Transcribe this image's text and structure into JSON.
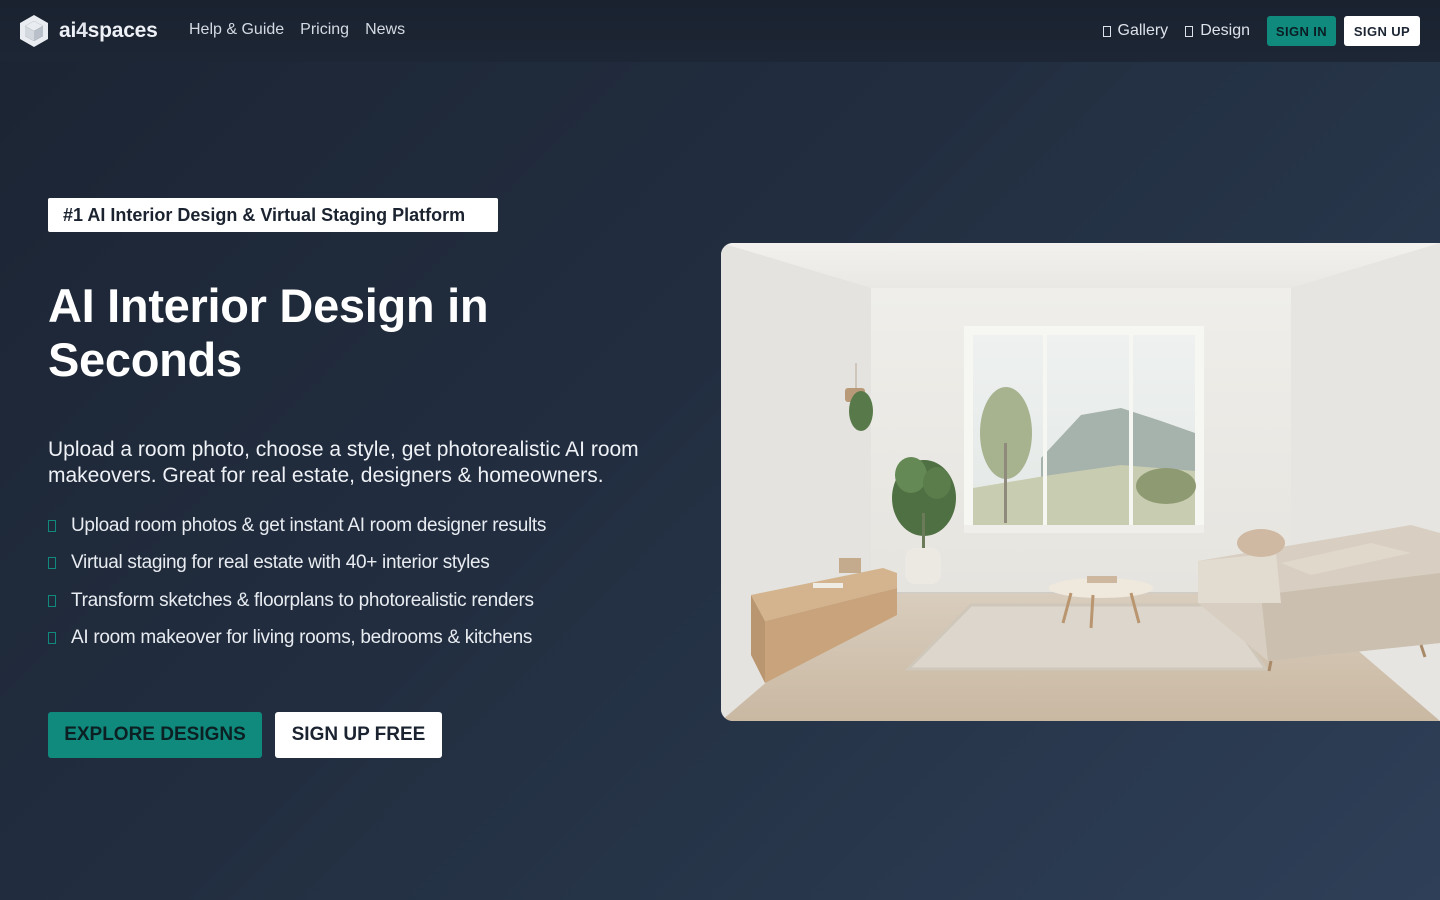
{
  "nav": {
    "brand_prefix": "ai",
    "brand_digit": "4",
    "brand_suffix": "spaces",
    "links": [
      "Help & Guide",
      "Pricing",
      "News"
    ],
    "gallery_label": "Gallery",
    "design_label": "Design",
    "signin_label": "SIGN IN",
    "signup_label": "SIGN UP"
  },
  "hero": {
    "badge": "#1 AI Interior Design & Virtual Staging Platform",
    "headline_line1": "AI Interior Design in",
    "headline_line2": "Seconds",
    "subline": "Upload a room photo, choose a style, get photorealistic AI room makeovers. Great for real estate, designers & homeowners.",
    "features": [
      "Upload room photos & get instant AI room designer results",
      "Virtual staging for real estate with 40+ interior styles",
      "Transform sketches & floorplans to photorealistic renders",
      "AI room makeover for living rooms, bedrooms & kitchens"
    ],
    "explore_label": "EXPLORE DESIGNS",
    "signup_free_label": "SIGN UP FREE"
  },
  "icons": {
    "logo": "cube-logo-icon",
    "gallery": "gallery-icon",
    "design": "design-icon",
    "feature_check": "check-icon"
  },
  "colors": {
    "accent": "#0f8a7d",
    "background": "#222e40",
    "white": "#ffffff"
  }
}
